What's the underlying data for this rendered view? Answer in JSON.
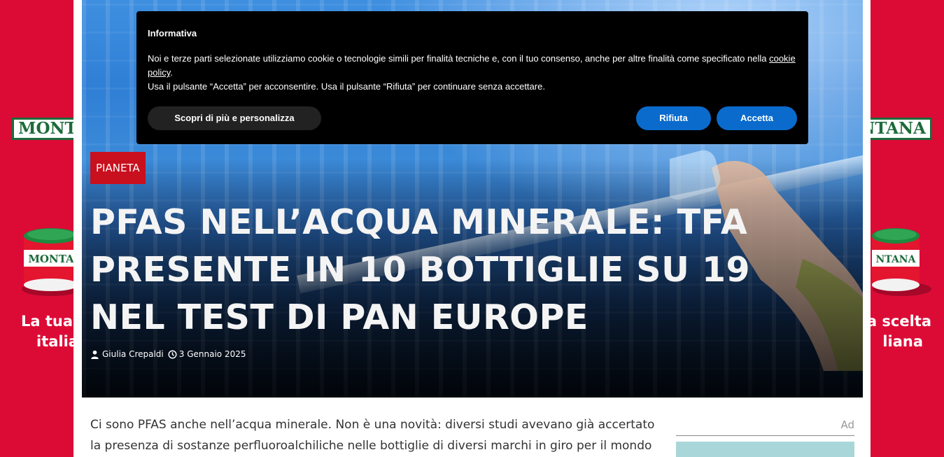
{
  "ad_skin": {
    "brand": "MONTANA",
    "slogan_left_line1": "La tua s",
    "slogan_left_line2": "italia",
    "slogan_right_line1": "a scelta",
    "slogan_right_line2": "liana",
    "can_brand": "MONTANA",
    "color_background": "#dc0b36",
    "color_brand_green": "#1d6b3a"
  },
  "article": {
    "category": "PIANETA",
    "title": "PFAS NELL’ACQUA MINERALE: TFA PRESENTE IN 10 BOTTIGLIE SU 19 NEL TEST DI PAN EUROPE",
    "author": "Giulia Crepaldi",
    "date": "3 Gennaio 2025",
    "body_intro": "Ci sono PFAS anche nell’acqua minerale. Non è una novità: diversi studi avevano già accertato la presenza di sostanze perfluoroalchiliche nelle bottiglie di diversi marchi in giro per il mondo (ne",
    "color_category": "#c8101e"
  },
  "sidebar": {
    "ad_label": "Ad"
  },
  "cookie_banner": {
    "title": "Informativa",
    "text_part1": "Noi e terze parti selezionate utilizziamo cookie o tecnologie simili per finalità tecniche e, con il tuo consenso, anche per altre finalità come specificato nella ",
    "policy_link": "cookie policy",
    "text_part2": ".",
    "text_line2": "Usa il pulsante “Accetta” per acconsentire. Usa il pulsante “Rifiuta” per continuare senza accettare.",
    "customize_label": "Scopri di più e personalizza",
    "reject_label": "Rifiuta",
    "accept_label": "Accetta",
    "color_button": "#0a6bcd"
  },
  "icons": {
    "author": "user-icon",
    "date": "clock-icon"
  }
}
